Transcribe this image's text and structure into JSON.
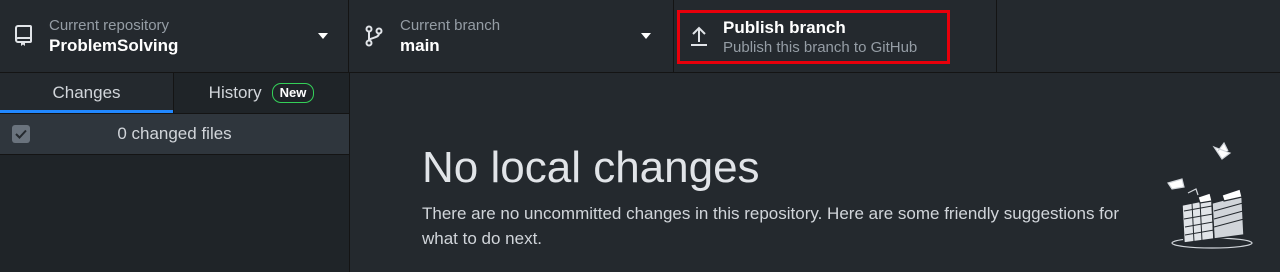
{
  "toolbar": {
    "repository": {
      "label": "Current repository",
      "value": "ProblemSolving"
    },
    "branch": {
      "label": "Current branch",
      "value": "main"
    },
    "publish": {
      "title": "Publish branch",
      "subtitle": "Publish this branch to GitHub"
    }
  },
  "sidebar": {
    "tabs": [
      {
        "label": "Changes",
        "selected": true
      },
      {
        "label": "History",
        "badge": "New"
      }
    ],
    "changes_summary": "0 changed files"
  },
  "main": {
    "title": "No local changes",
    "description": "There are no uncommitted changes in this repository. Here are some friendly suggestions for what to do next."
  },
  "colors": {
    "accent": "#2188ff",
    "highlight": "#e8000b",
    "badge_border": "#34d058"
  },
  "icons": {
    "repository": "repo-icon",
    "branch": "git-branch-icon",
    "publish": "upload-icon"
  }
}
